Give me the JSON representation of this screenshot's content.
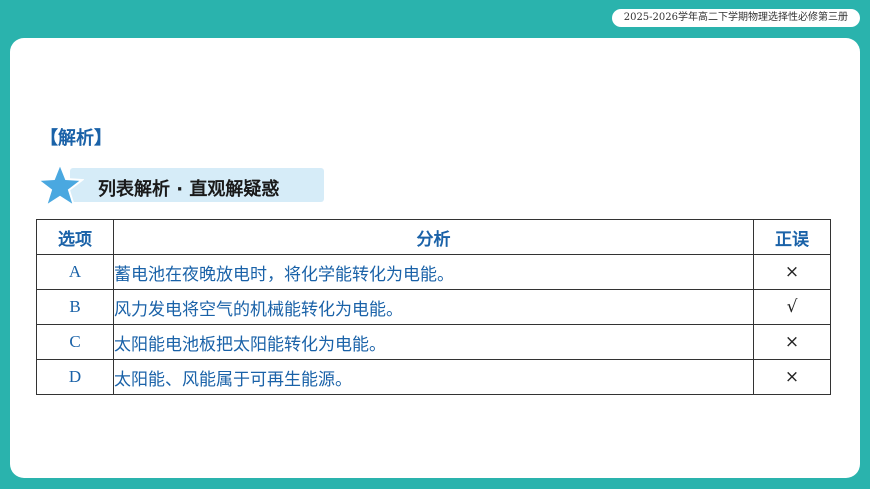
{
  "header": {
    "course": "2025-2026学年高二下学期物理选择性必修第三册"
  },
  "section": {
    "label": "【解析】",
    "ribbon": "列表解析 · 直观解疑惑"
  },
  "table": {
    "headers": [
      "选项",
      "分析",
      "正误"
    ],
    "rows": [
      {
        "option": "A",
        "analysis": "蓄电池在夜晚放电时，将化学能转化为电能。",
        "verdict": "×"
      },
      {
        "option": "B",
        "analysis": "风力发电将空气的机械能转化为电能。",
        "verdict": "√"
      },
      {
        "option": "C",
        "analysis": "太阳能电池板把太阳能转化为电能。",
        "verdict": "×"
      },
      {
        "option": "D",
        "analysis": "太阳能、风能属于可再生能源。",
        "verdict": "×"
      }
    ]
  },
  "colors": {
    "teal": "#2ab3ad",
    "blue": "#1a62a8",
    "star": "#4aa8e0",
    "ribbon": "#d6ecf8"
  },
  "icons": {
    "ribbon": "star-icon"
  }
}
